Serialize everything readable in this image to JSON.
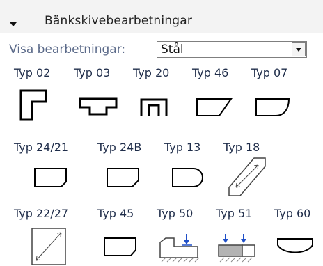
{
  "panel": {
    "title": "Bänkskivebearbetningar",
    "filter_label": "Visa bearbetningar:",
    "filter_value": "Stål"
  },
  "types": [
    {
      "label": "Typ 02",
      "icon": "corner-cut-icon"
    },
    {
      "label": "Typ 03",
      "icon": "slot-edge-icon"
    },
    {
      "label": "Typ 20",
      "icon": "u-profile-icon"
    },
    {
      "label": "Typ 46",
      "icon": "angled-edge-icon"
    },
    {
      "label": "Typ 07",
      "icon": "rounded-corner-icon"
    },
    {
      "label": "Typ 24/21",
      "icon": "bevel-left-edge-icon"
    },
    {
      "label": "Typ 24B",
      "icon": "bevel-right-edge-icon"
    },
    {
      "label": "Typ 13",
      "icon": "half-round-edge-icon"
    },
    {
      "label": "Typ 18",
      "icon": "diagonal-measure-icon"
    },
    {
      "label": "Typ 22/27",
      "icon": "diagonal-arrow-icon"
    },
    {
      "label": "Typ 45",
      "icon": "bevel-edge-icon"
    },
    {
      "label": "Typ 50",
      "icon": "step-down-arrow-icon"
    },
    {
      "label": "Typ 51",
      "icon": "double-arrow-block-icon"
    },
    {
      "label": "Typ 60",
      "icon": "curved-bottom-icon"
    }
  ]
}
